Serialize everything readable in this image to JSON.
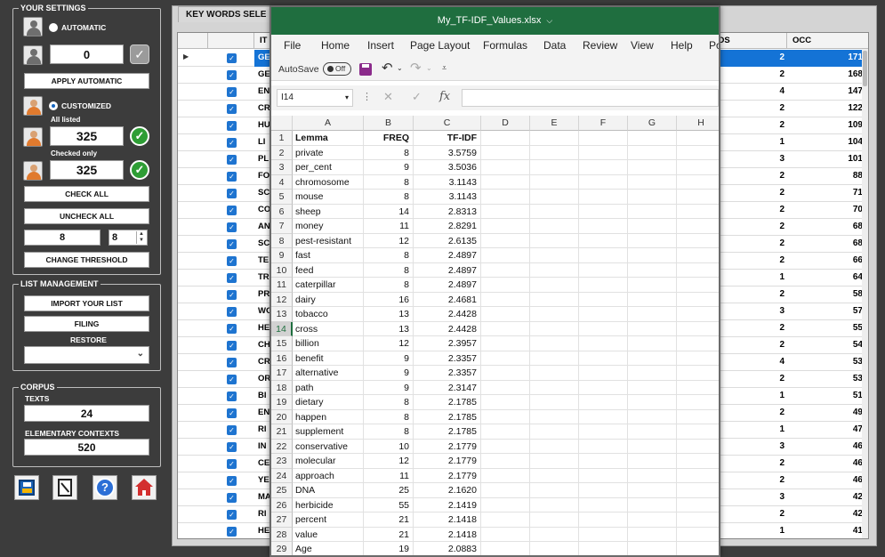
{
  "left_panel": {
    "your_settings": "YOUR SETTINGS",
    "automatic": "AUTOMATIC",
    "auto_value": "0",
    "apply_automatic": "APPLY AUTOMATIC",
    "customized": "CUSTOMIZED",
    "all_listed": "All listed",
    "all_listed_value": "325",
    "checked_only": "Checked only",
    "checked_only_value": "325",
    "check_all": "CHECK ALL",
    "uncheck_all": "UNCHECK ALL",
    "threshold_a": "8",
    "threshold_b": "8",
    "change_threshold": "CHANGE THRESHOLD",
    "list_management": "LIST MANAGEMENT",
    "import_list": "IMPORT YOUR LIST",
    "filing": "FILING",
    "restore": "RESTORE",
    "corpus": "CORPUS",
    "texts": "TEXTS",
    "texts_value": "24",
    "elementary_contexts": "ELEMENTARY CONTEXTS",
    "elementary_value": "520",
    "icons": [
      "save-icon",
      "notebook-icon",
      "help-icon",
      "home-icon"
    ]
  },
  "bg_window": {
    "tab": "KEY WORDS SELE",
    "col_it": "IT",
    "col_pos": "OS",
    "col_occ": "OCC",
    "rows": [
      {
        "prefix": "GE",
        "pos": "2",
        "occ": "171"
      },
      {
        "prefix": "GE",
        "pos": "2",
        "occ": "168"
      },
      {
        "prefix": "EN",
        "pos": "4",
        "occ": "147"
      },
      {
        "prefix": "CR",
        "pos": "2",
        "occ": "122"
      },
      {
        "prefix": "HU",
        "pos": "2",
        "occ": "109"
      },
      {
        "prefix": "LI",
        "pos": "1",
        "occ": "104"
      },
      {
        "prefix": "PL",
        "pos": "3",
        "occ": "101"
      },
      {
        "prefix": "FO",
        "pos": "2",
        "occ": "88"
      },
      {
        "prefix": "SC",
        "pos": "2",
        "occ": "71"
      },
      {
        "prefix": "CO",
        "pos": "2",
        "occ": "70"
      },
      {
        "prefix": "AN",
        "pos": "2",
        "occ": "68"
      },
      {
        "prefix": "SC",
        "pos": "2",
        "occ": "68"
      },
      {
        "prefix": "TE",
        "pos": "2",
        "occ": "66"
      },
      {
        "prefix": "TR",
        "pos": "1",
        "occ": "64"
      },
      {
        "prefix": "PR",
        "pos": "2",
        "occ": "58"
      },
      {
        "prefix": "WO",
        "pos": "3",
        "occ": "57"
      },
      {
        "prefix": "HE",
        "pos": "2",
        "occ": "55"
      },
      {
        "prefix": "CH",
        "pos": "2",
        "occ": "54"
      },
      {
        "prefix": "CR",
        "pos": "4",
        "occ": "53"
      },
      {
        "prefix": "OR",
        "pos": "2",
        "occ": "53"
      },
      {
        "prefix": "BI",
        "pos": "1",
        "occ": "51"
      },
      {
        "prefix": "EN",
        "pos": "2",
        "occ": "49"
      },
      {
        "prefix": "RI",
        "pos": "1",
        "occ": "47"
      },
      {
        "prefix": "IN",
        "pos": "3",
        "occ": "46"
      },
      {
        "prefix": "CE",
        "pos": "2",
        "occ": "46"
      },
      {
        "prefix": "YE",
        "pos": "2",
        "occ": "46"
      },
      {
        "prefix": "MA",
        "pos": "3",
        "occ": "42"
      },
      {
        "prefix": "RI",
        "pos": "2",
        "occ": "42"
      },
      {
        "prefix": "HE",
        "pos": "1",
        "occ": "41"
      }
    ]
  },
  "excel": {
    "title": "My_TF-IDF_Values.xlsx",
    "menu": [
      "File",
      "Home",
      "Insert",
      "Page Layout",
      "Formulas",
      "Data",
      "Review",
      "View",
      "Help",
      "Po"
    ],
    "autosave": "AutoSave",
    "autosave_state": "Off",
    "name_box": "I14",
    "columns": [
      "A",
      "B",
      "C",
      "D",
      "E",
      "F",
      "G",
      "H"
    ],
    "header": {
      "a": "Lemma",
      "b": "FREQ",
      "c": "TF-IDF"
    },
    "rows": [
      {
        "lemma": "private",
        "freq": "8",
        "tfidf": "3.5759"
      },
      {
        "lemma": "per_cent",
        "freq": "9",
        "tfidf": "3.5036"
      },
      {
        "lemma": "chromosome",
        "freq": "8",
        "tfidf": "3.1143"
      },
      {
        "lemma": "mouse",
        "freq": "8",
        "tfidf": "3.1143"
      },
      {
        "lemma": "sheep",
        "freq": "14",
        "tfidf": "2.8313"
      },
      {
        "lemma": "money",
        "freq": "11",
        "tfidf": "2.8291"
      },
      {
        "lemma": "pest-resistant",
        "freq": "12",
        "tfidf": "2.6135"
      },
      {
        "lemma": "fast",
        "freq": "8",
        "tfidf": "2.4897"
      },
      {
        "lemma": "feed",
        "freq": "8",
        "tfidf": "2.4897"
      },
      {
        "lemma": "caterpillar",
        "freq": "8",
        "tfidf": "2.4897"
      },
      {
        "lemma": "dairy",
        "freq": "16",
        "tfidf": "2.4681"
      },
      {
        "lemma": "tobacco",
        "freq": "13",
        "tfidf": "2.4428"
      },
      {
        "lemma": "cross",
        "freq": "13",
        "tfidf": "2.4428"
      },
      {
        "lemma": "billion",
        "freq": "12",
        "tfidf": "2.3957"
      },
      {
        "lemma": "benefit",
        "freq": "9",
        "tfidf": "2.3357"
      },
      {
        "lemma": "alternative",
        "freq": "9",
        "tfidf": "2.3357"
      },
      {
        "lemma": "path",
        "freq": "9",
        "tfidf": "2.3147"
      },
      {
        "lemma": "dietary",
        "freq": "8",
        "tfidf": "2.1785"
      },
      {
        "lemma": "happen",
        "freq": "8",
        "tfidf": "2.1785"
      },
      {
        "lemma": "supplement",
        "freq": "8",
        "tfidf": "2.1785"
      },
      {
        "lemma": "conservative",
        "freq": "10",
        "tfidf": "2.1779"
      },
      {
        "lemma": "molecular",
        "freq": "12",
        "tfidf": "2.1779"
      },
      {
        "lemma": "approach",
        "freq": "11",
        "tfidf": "2.1779"
      },
      {
        "lemma": "DNA",
        "freq": "25",
        "tfidf": "2.1620"
      },
      {
        "lemma": "herbicide",
        "freq": "55",
        "tfidf": "2.1419"
      },
      {
        "lemma": "percent",
        "freq": "21",
        "tfidf": "2.1418"
      },
      {
        "lemma": "value",
        "freq": "21",
        "tfidf": "2.1418"
      },
      {
        "lemma": "Age",
        "freq": "19",
        "tfidf": "2.0883"
      }
    ],
    "active_row": 14
  },
  "colors": {
    "excel_green": "#1f6e3f",
    "selection_blue": "#1473d6",
    "panel_bg": "#3c3c3c"
  }
}
